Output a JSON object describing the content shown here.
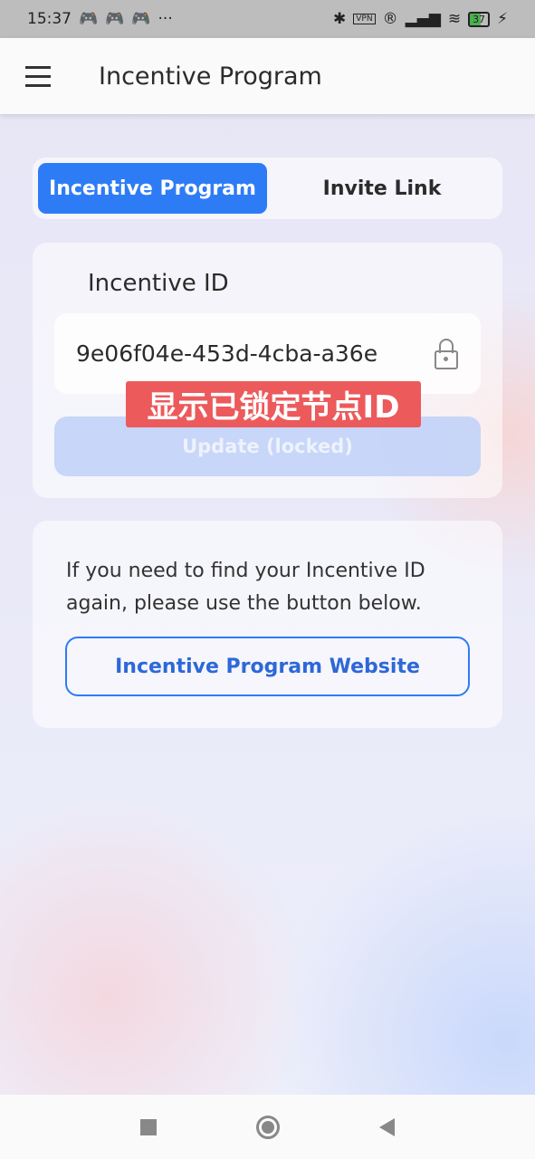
{
  "status_bar": {
    "time": "15:37",
    "dots": "···",
    "vpn": "VPN",
    "r": "®",
    "battery": "37",
    "icons": [
      "game-icon",
      "game-icon",
      "game-icon",
      "bluetooth-icon",
      "vpn-icon",
      "registered-icon",
      "signal-icon",
      "wifi-icon",
      "battery-icon",
      "charging-icon"
    ]
  },
  "app_bar": {
    "title": "Incentive Program",
    "menu_icon": "hamburger-icon"
  },
  "tabs": [
    {
      "label": "Incentive Program",
      "active": true
    },
    {
      "label": "Invite Link",
      "active": false
    }
  ],
  "id_card": {
    "label": "Incentive ID",
    "value": "9e06f04e-453d-4cba-a36e",
    "lock_icon": "lock-icon",
    "overlay": "显示已锁定节点ID",
    "update_button": "Update (locked)"
  },
  "info_card": {
    "text": "If you need to find your Incentive ID again, please use the button below.",
    "button": "Incentive Program Website"
  },
  "nav_bar": {
    "icons": [
      "recents-icon",
      "home-icon",
      "back-icon"
    ]
  },
  "colors": {
    "accent": "#2d7cf6",
    "overlay": "#ec5a5c"
  }
}
